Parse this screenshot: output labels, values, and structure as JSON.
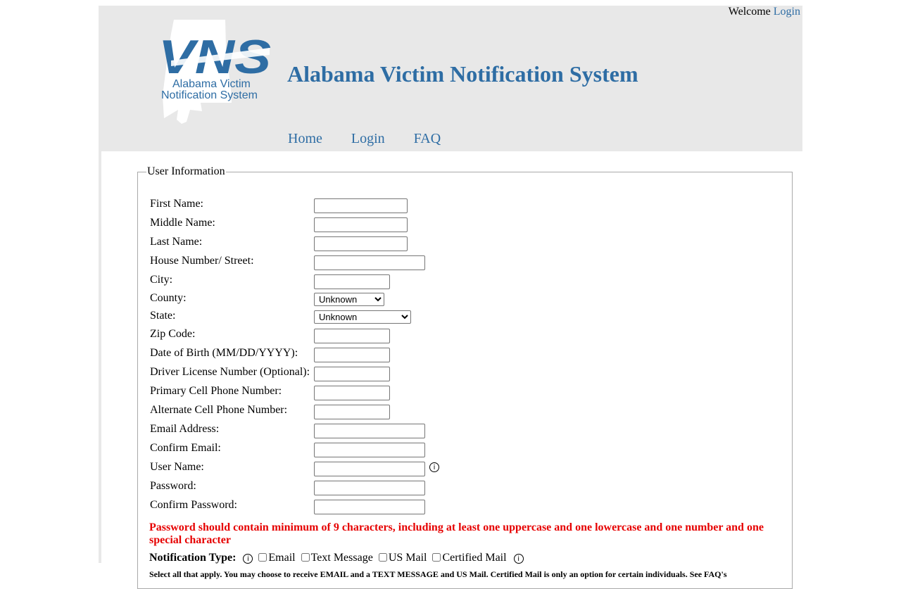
{
  "header": {
    "welcome_text": "Welcome",
    "login_link": "Login",
    "site_title": "Alabama Victim Notification System",
    "logo": {
      "mark": "VNS",
      "line1": "Alabama Victim",
      "line2": "Notification System"
    }
  },
  "nav": {
    "items": [
      {
        "label": "Home"
      },
      {
        "label": "Login"
      },
      {
        "label": "FAQ"
      }
    ]
  },
  "form": {
    "legend": "User Information",
    "fields": {
      "first_name": {
        "label": "First Name:",
        "value": ""
      },
      "middle_name": {
        "label": "Middle Name:",
        "value": ""
      },
      "last_name": {
        "label": "Last Name:",
        "value": ""
      },
      "street": {
        "label": "House Number/ Street:",
        "value": ""
      },
      "city": {
        "label": "City:",
        "value": ""
      },
      "county": {
        "label": "County:",
        "selected": "Unknown"
      },
      "state": {
        "label": "State:",
        "selected": "Unknown"
      },
      "zip": {
        "label": "Zip Code:",
        "value": ""
      },
      "dob": {
        "label": "Date of Birth (MM/DD/YYYY):",
        "value": ""
      },
      "dl": {
        "label": "Driver License Number (Optional):",
        "value": ""
      },
      "primary_phone": {
        "label": "Primary Cell Phone Number:",
        "value": ""
      },
      "alt_phone": {
        "label": "Alternate Cell Phone Number:",
        "value": ""
      },
      "email": {
        "label": "Email Address:",
        "value": ""
      },
      "confirm_email": {
        "label": "Confirm Email:",
        "value": ""
      },
      "username": {
        "label": "User Name:",
        "value": ""
      },
      "password": {
        "label": "Password:",
        "value": ""
      },
      "confirm_password": {
        "label": "Confirm Password:",
        "value": ""
      }
    },
    "password_note": "Password should contain minimum of 9 characters, including at least one uppercase and one lowercase and one number and one special character",
    "notification": {
      "label": "Notification Type:",
      "options": [
        "Email",
        "Text Message",
        "US Mail",
        "Certified Mail"
      ]
    },
    "select_note": "Select all that apply. You may choose to receive EMAIL and a TEXT MESSAGE and US Mail. Certified Mail is only an option for certain individuals. See FAQ's"
  },
  "colors": {
    "brand_blue": "#2e6da4",
    "warning_red": "#e60000",
    "header_bg": "#e8e8e8"
  },
  "icons": [
    "info-icon",
    "alabama-map-logo"
  ]
}
